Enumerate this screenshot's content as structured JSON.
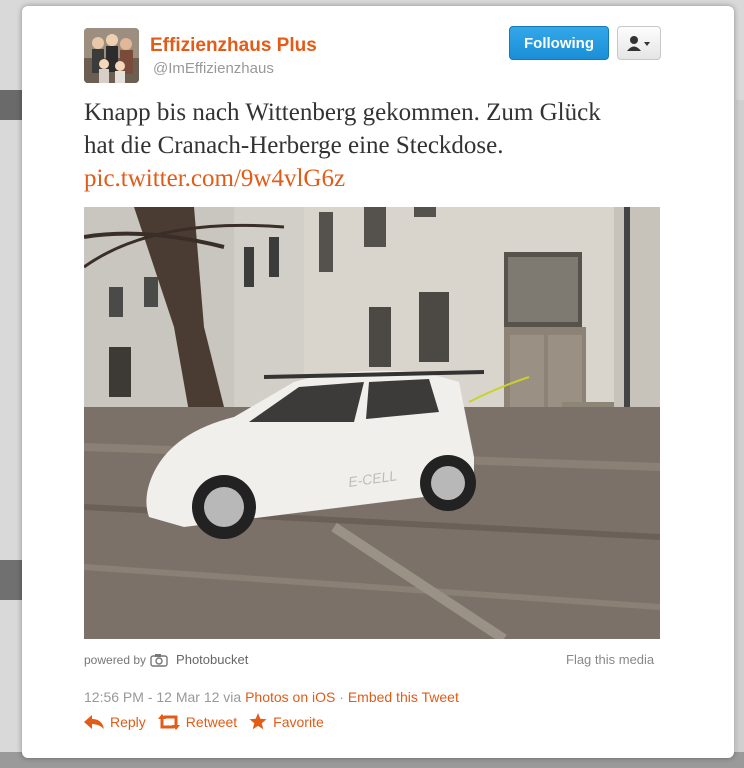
{
  "author": {
    "name": "Effizienzhaus Plus",
    "handle": "@ImEffizienzhaus"
  },
  "header": {
    "follow_label": "Following"
  },
  "tweet": {
    "text_line1": "Knapp bis nach Wittenberg gekommen. Zum Glück",
    "text_line2": "hat die Cranach-Herberge eine Steckdose.",
    "link": "pic.twitter.com/9w4vlG6z"
  },
  "media": {
    "car_badge": "E-CELL",
    "powered_by": "powered by",
    "provider": "Photobucket",
    "flag_label": "Flag this media"
  },
  "meta": {
    "timestamp": "12:56 PM - 12 Mar 12 via",
    "source": "Photos on iOS",
    "separator": "·",
    "embed": "Embed this Tweet"
  },
  "actions": {
    "reply": "Reply",
    "retweet": "Retweet",
    "favorite": "Favorite"
  },
  "colors": {
    "accent": "#e25b17",
    "follow_button": "#1a8fd6"
  }
}
